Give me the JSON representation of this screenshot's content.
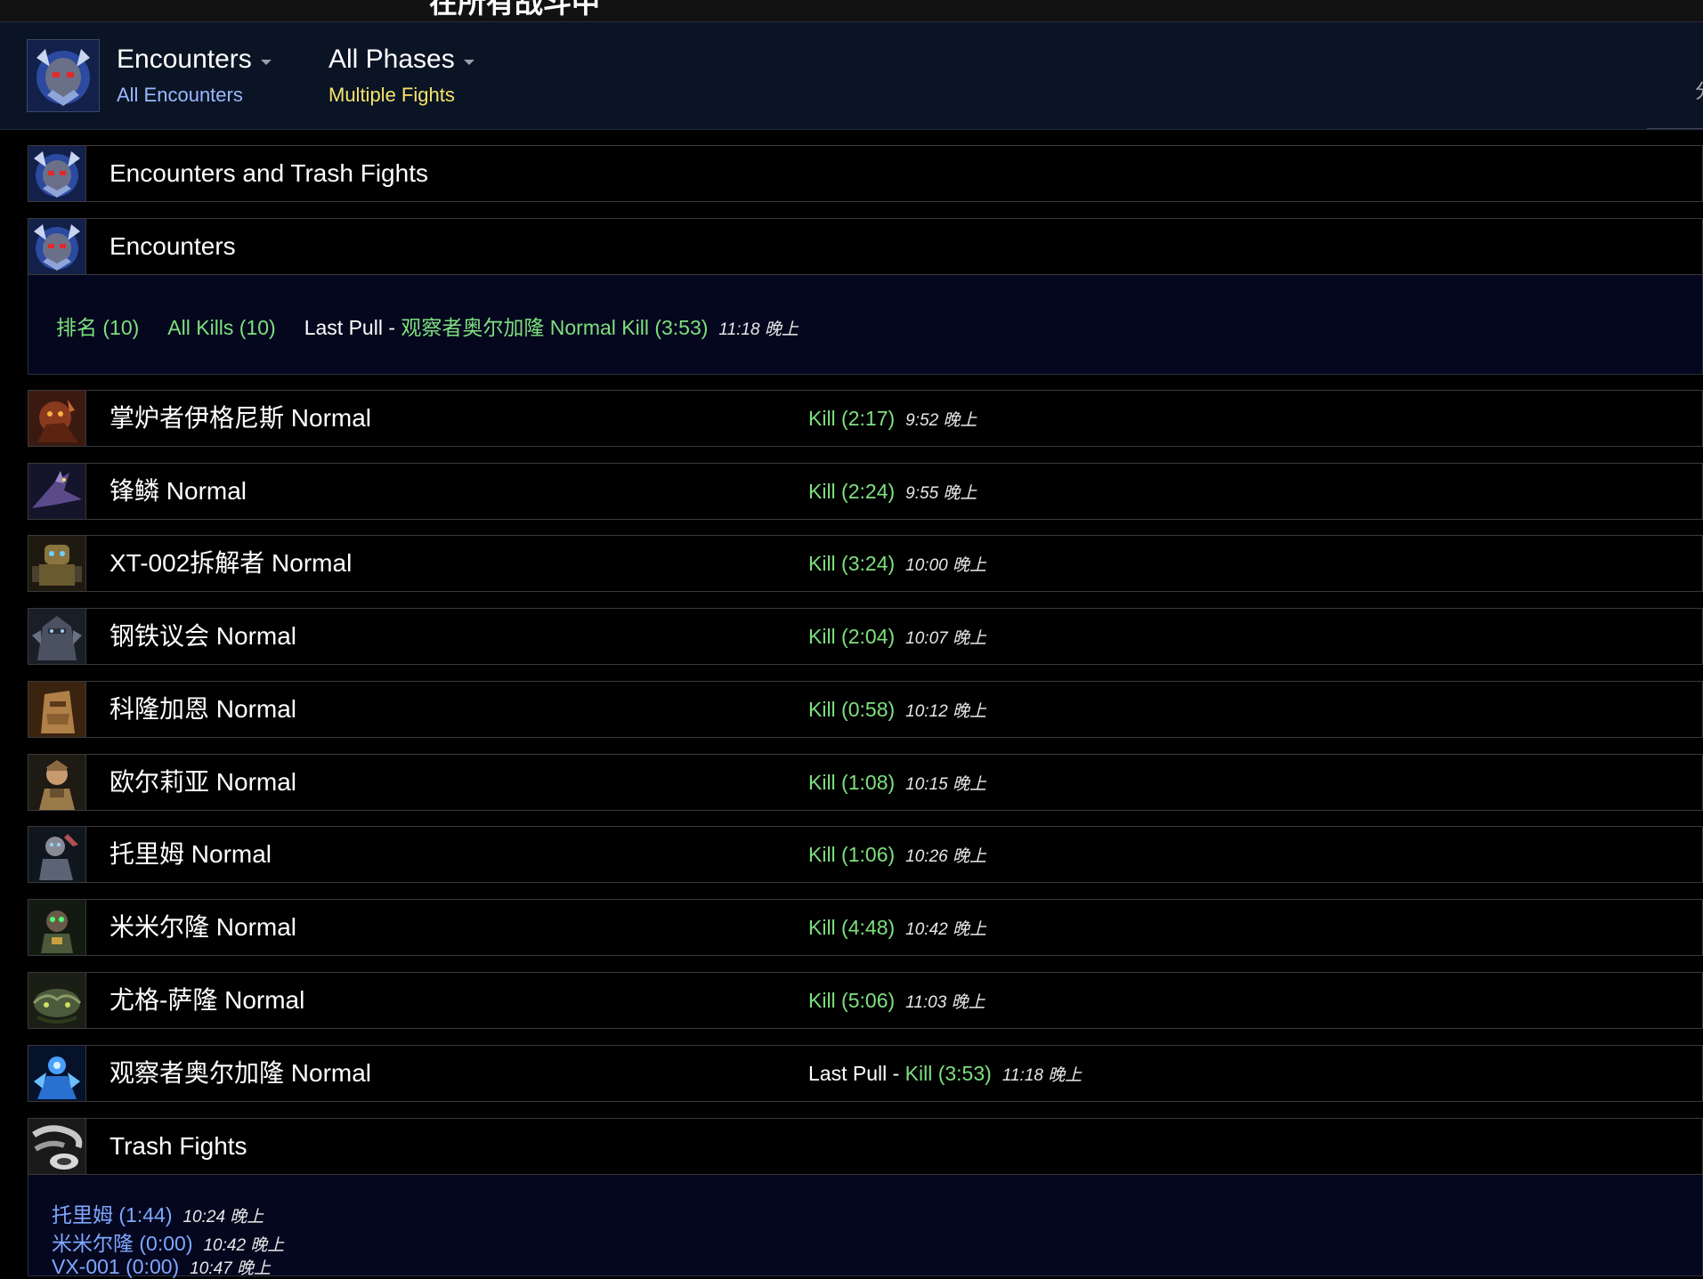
{
  "top_strip": {
    "cut_title": "在所有战斗中"
  },
  "header": {
    "encounters_menu": {
      "title": "Encounters",
      "subtitle": "All Encounters"
    },
    "phases_menu": {
      "title": "All Phases",
      "subtitle": "Multiple Fights"
    },
    "edge_glyph": "分"
  },
  "sections": {
    "encounters_and_trash": "Encounters and Trash Fights",
    "encounters": "Encounters",
    "trash_fights": "Trash Fights"
  },
  "encounters_panel": {
    "rank_link": "排名 (10)",
    "all_kills_link": "All Kills (10)",
    "last_pull_prefix": "Last Pull - ",
    "last_pull_link": "观察者奥尔加隆 Normal Kill (3:53)",
    "last_pull_time": "11:18 晚上"
  },
  "encounters_list": [
    {
      "name": "掌炉者伊格尼斯 Normal",
      "result": "Kill (2:17)",
      "time": "9:52 晚上",
      "icon": "ignis-icon"
    },
    {
      "name": "锋鳞 Normal",
      "result": "Kill (2:24)",
      "time": "9:55 晚上",
      "icon": "razorscale-icon"
    },
    {
      "name": "XT-002拆解者 Normal",
      "result": "Kill (3:24)",
      "time": "10:00 晚上",
      "icon": "xt002-icon"
    },
    {
      "name": "钢铁议会 Normal",
      "result": "Kill (2:04)",
      "time": "10:07 晚上",
      "icon": "iron-council-icon"
    },
    {
      "name": "科隆加恩 Normal",
      "result": "Kill (0:58)",
      "time": "10:12 晚上",
      "icon": "kologarn-icon"
    },
    {
      "name": "欧尔莉亚 Normal",
      "result": "Kill (1:08)",
      "time": "10:15 晚上",
      "icon": "auriaya-icon"
    },
    {
      "name": "托里姆 Normal",
      "result": "Kill (1:06)",
      "time": "10:26 晚上",
      "icon": "thorim-icon"
    },
    {
      "name": "米米尔隆 Normal",
      "result": "Kill (4:48)",
      "time": "10:42 晚上",
      "icon": "mimiron-icon"
    },
    {
      "name": "尤格-萨隆 Normal",
      "result": "Kill (5:06)",
      "time": "11:03 晚上",
      "icon": "yogg-saron-icon"
    },
    {
      "name": "观察者奥尔加隆 Normal",
      "prefix": "Last Pull - ",
      "result": "Kill (3:53)",
      "time": "11:18 晚上",
      "icon": "algalon-icon"
    }
  ],
  "trash_list": [
    {
      "name": "托里姆 (1:44)",
      "time": "10:24 晚上"
    },
    {
      "name": "米米尔隆 (0:00)",
      "time": "10:42 晚上"
    },
    {
      "name": "VX-001 (0:00)",
      "time": "10:47 晚上"
    }
  ],
  "colors": {
    "kill_green": "#7ee07e",
    "encounters_subtitle": "#9ab8ff",
    "phases_subtitle": "#f5e26b",
    "trash_link": "#7fa7ff",
    "panel_bg": "#04071e",
    "header_bg": "#0a1424"
  }
}
